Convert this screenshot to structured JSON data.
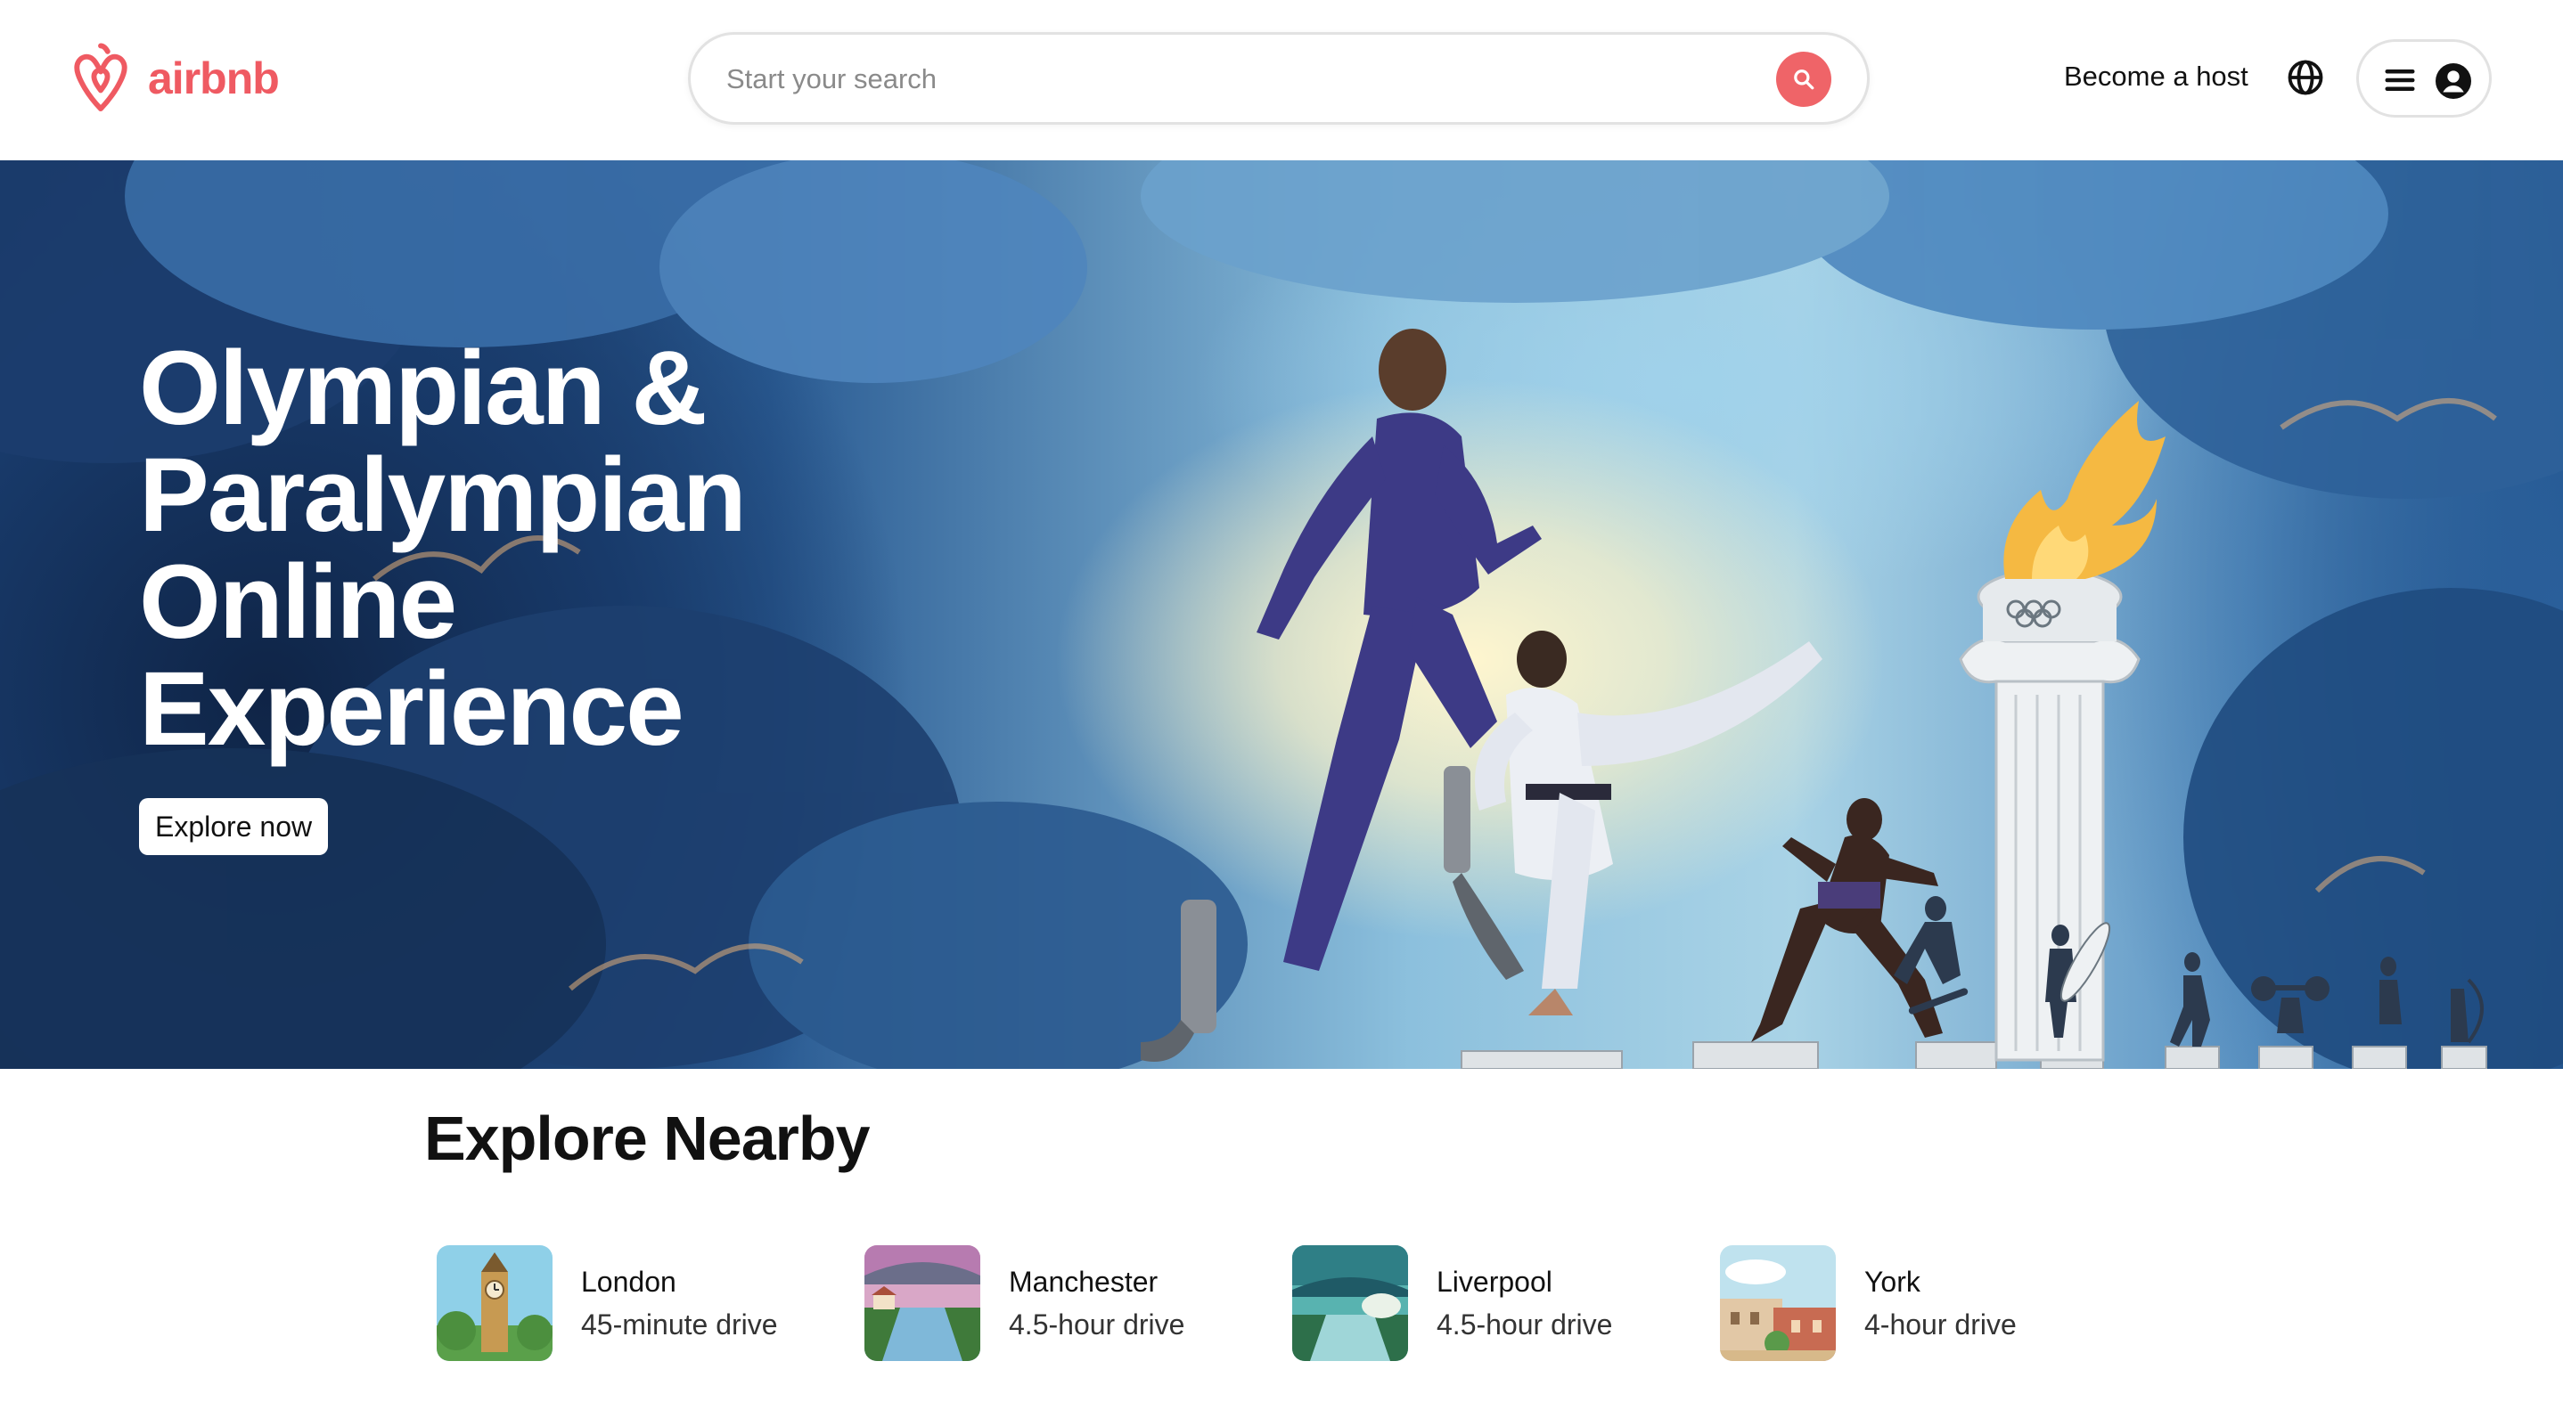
{
  "brand": {
    "name": "airbnb",
    "color": "#ef5a62"
  },
  "search": {
    "placeholder": "Start your search",
    "button_color": "#ef6468"
  },
  "nav": {
    "become_host": "Become a host",
    "globe_icon": "globe-icon",
    "menu_icon": "hamburger-menu-icon",
    "avatar_icon": "user-avatar-icon"
  },
  "hero": {
    "title_lines": [
      "Olympian &",
      "Paralympian",
      "Online",
      "Experience"
    ],
    "cta": "Explore now"
  },
  "nearby": {
    "title": "Explore Nearby",
    "items": [
      {
        "city": "London",
        "distance": "45-minute drive"
      },
      {
        "city": "Manchester",
        "distance": "4.5-hour drive"
      },
      {
        "city": "Liverpool",
        "distance": "4.5-hour drive"
      },
      {
        "city": "York",
        "distance": "4-hour drive"
      }
    ]
  }
}
